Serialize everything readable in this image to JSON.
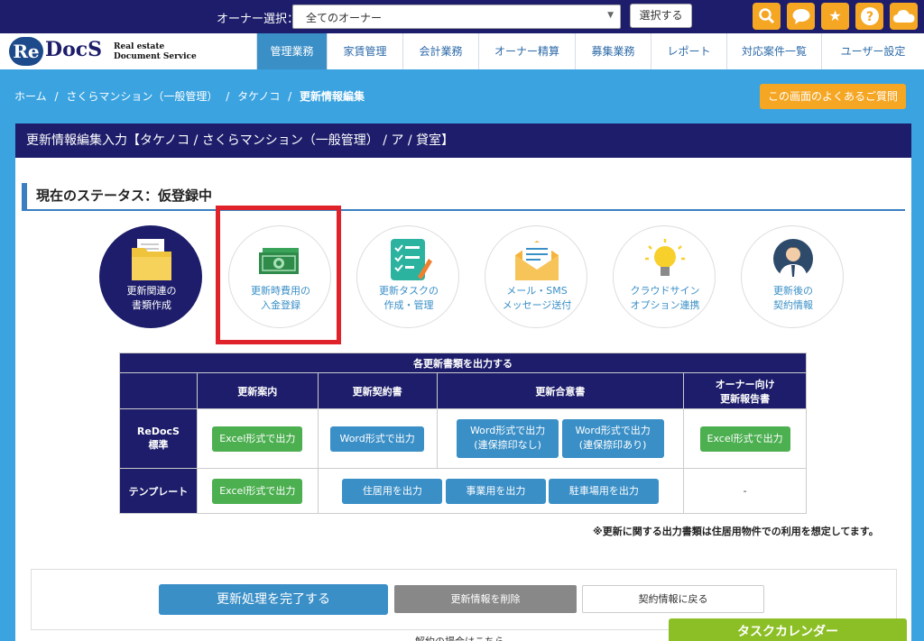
{
  "topbar": {
    "owner_label": "オーナー選択：",
    "owner_select_value": "全てのオーナー",
    "select_button": "選択する",
    "icons": [
      "search-icon",
      "chat-icon",
      "star-icon",
      "help-icon",
      "cloud-icon"
    ]
  },
  "logo": {
    "re": "Re",
    "docs": "DocS",
    "sub1": "Real estate",
    "sub2": "Document Service"
  },
  "nav": [
    {
      "label": "管理業務",
      "active": true
    },
    {
      "label": "家賃管理"
    },
    {
      "label": "会計業務"
    },
    {
      "label": "オーナー精算"
    },
    {
      "label": "募集業務"
    },
    {
      "label": "レポート"
    },
    {
      "label": "対応案件一覧"
    },
    {
      "label": "ユーザー設定"
    }
  ],
  "breadcrumb": {
    "home": "ホーム",
    "sep": "/",
    "item1": "さくらマンション（一般管理）",
    "item2": "タケノコ",
    "current": "更新情報編集"
  },
  "faq_button": "この画面のよくあるご質問",
  "panel": {
    "title": "更新情報編集入力【タケノコ / さくらマンション（一般管理） / ア / 貸室】",
    "status": "現在のステータス：仮登録中"
  },
  "circles": [
    {
      "line1": "更新関連の",
      "line2": "書類作成",
      "icon": "folder-icon"
    },
    {
      "line1": "更新時費用の",
      "line2": "入金登録",
      "icon": "money-icon"
    },
    {
      "line1": "更新タスクの",
      "line2": "作成・管理",
      "icon": "checklist-icon"
    },
    {
      "line1": "メール・SMS",
      "line2": "メッセージ送付",
      "icon": "mail-icon"
    },
    {
      "line1": "クラウドサイン",
      "line2": "オプション連携",
      "icon": "bulb-icon"
    },
    {
      "line1": "更新後の",
      "line2": "契約情報",
      "icon": "person-icon"
    }
  ],
  "table": {
    "caption": "各更新書類を出力する",
    "headers": [
      "更新案内",
      "更新契約書",
      "更新合意書",
      "オーナー向け",
      "更新報告書"
    ],
    "row1_label_a": "ReDocS",
    "row1_label_b": "標準",
    "row1": {
      "guide": "Excel形式で出力",
      "contract": "Word形式で出力",
      "agree1_a": "Word形式で出力",
      "agree1_b": "(連保捺印なし)",
      "agree2_a": "Word形式で出力",
      "agree2_b": "(連保捺印あり)",
      "report": "Excel形式で出力"
    },
    "row2_label": "テンプレート",
    "row2": {
      "guide": "Excel形式で出力",
      "res": "住居用を出力",
      "biz": "事業用を出力",
      "park": "駐車場用を出力",
      "report": "-"
    }
  },
  "note": "※更新に関する出力書類は住居用物件での利用を想定してます。",
  "actions": {
    "complete": "更新処理を完了する",
    "delete": "更新情報を削除",
    "back": "契約情報に戻る"
  },
  "task_calendar": "タスクカレンダー",
  "cutoff_text": "解約の場合はこちら"
}
